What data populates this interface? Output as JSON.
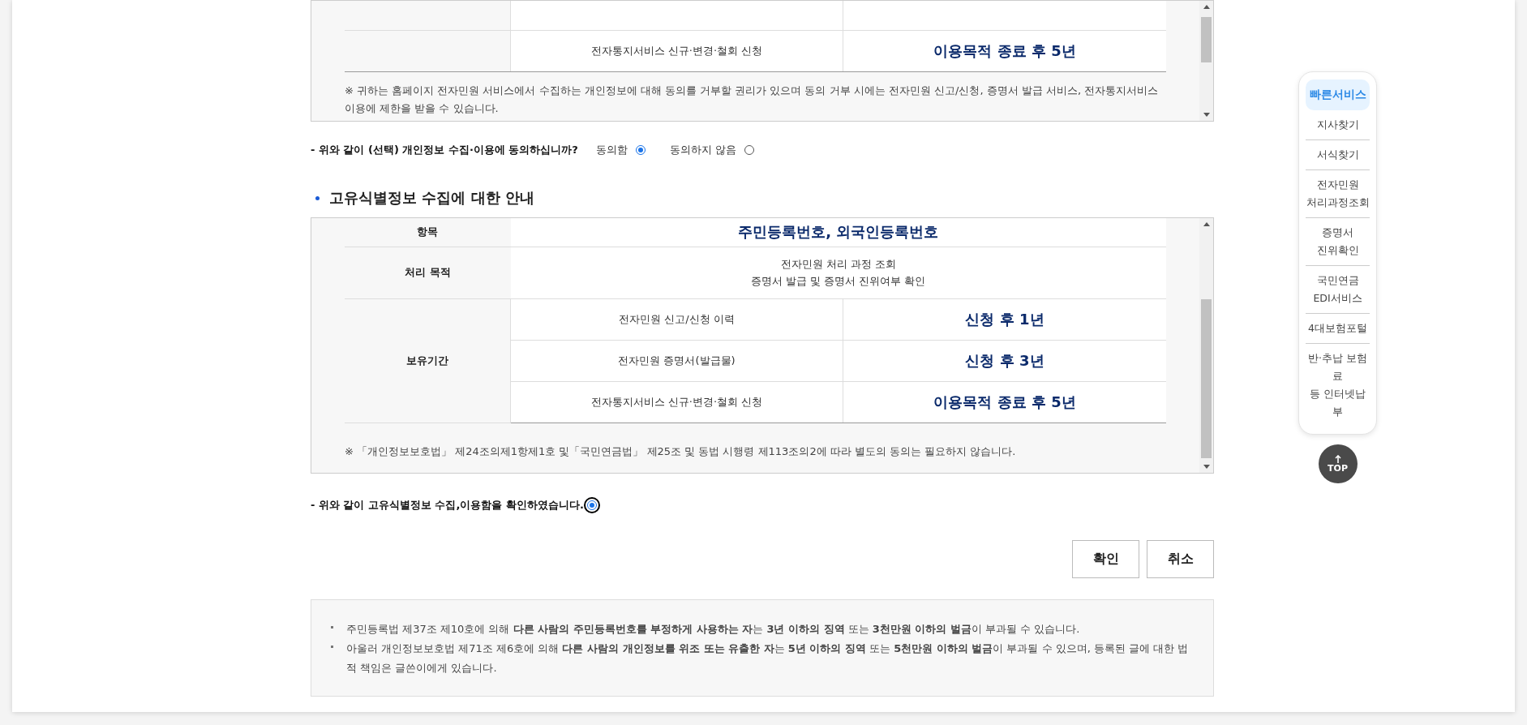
{
  "consent_table_panel": {
    "rows": [
      {
        "item": "전자통지서비스 신규·변경·철회 신청",
        "period": "이용목적 종료 후 5년"
      }
    ],
    "note": "※ 귀하는 홈페이지 전자민원 서비스에서 수집하는 개인정보에 대해 동의를 거부할 권리가 있으며 동의 거부 시에는 전자민원 신고/신청, 증명서 발급 서비스, 전자통지서비스 이용에 제한을 받을 수 있습니다."
  },
  "consent_question": {
    "label": "- 위와 같이 (선택) 개인정보 수집·이용에 동의하십니까?",
    "options": [
      {
        "label": "동의함",
        "selected": true
      },
      {
        "label": "동의하지 않음",
        "selected": false
      }
    ]
  },
  "unique_id_section": {
    "heading": "고유식별정보 수집에 대한 안내",
    "item_label": "항목",
    "item_value": "주민등록번호, 외국인등록번호",
    "purpose_label": "처리 목적",
    "purpose": "전자민원 처리 과정 조회\n증명서 발급 및 증명서 진위여부 확인",
    "retention_label": "보유기간",
    "retention_rows": [
      {
        "item": "전자민원 신고/신청 이력",
        "period": "신청 후 1년"
      },
      {
        "item": "전자민원 증명서(발급물)",
        "period": "신청 후 3년"
      },
      {
        "item": "전자통지서비스 신규·변경·철회 신청",
        "period": "이용목적 종료 후 5년"
      }
    ],
    "note": "※ 「개인정보보호법」 제24조의제1항제1호 및「국민연금법」 제25조 및 동법 시행령 제113조의2에 따라 별도의 동의는 필요하지 않습니다."
  },
  "confirm": {
    "label": "- 위와 같이 고유식별정보 수집,이용함을 확인하였습니다.",
    "selected": true
  },
  "buttons": [
    {
      "label": "확인"
    },
    {
      "label": "취소"
    }
  ],
  "warnings": [
    "주민등록법 제37조 제10호에 의해 **다른 사람의 주민등록번호를 부정하게 사용하는 자**는 **3년 이하의 징역** 또는 **3천만원 이하의 벌금**이 부과될 수 있습니다.",
    "아울러 개인정보보호법 제71조 제6호에 의해 **다른 사람의 개인정보를 위조 또는 유출한 자**는 **5년 이하의 징역** 또는 **5천만원 이하의 벌금**이 부과될 수 있으며, 등록된 글에 대한 법적 책임은 글쓴이에게 있습니다."
  ],
  "quick_menu": {
    "title": "빠른서비스",
    "items": [
      "지사찾기",
      "서식찾기",
      "전자민원\n처리과정조회",
      "증명서\n진위확인",
      "국민연금\nEDI서비스",
      "4대보험포털",
      "반·추납 보험료\n등 인터넷납부"
    ],
    "top_label": "TOP"
  }
}
